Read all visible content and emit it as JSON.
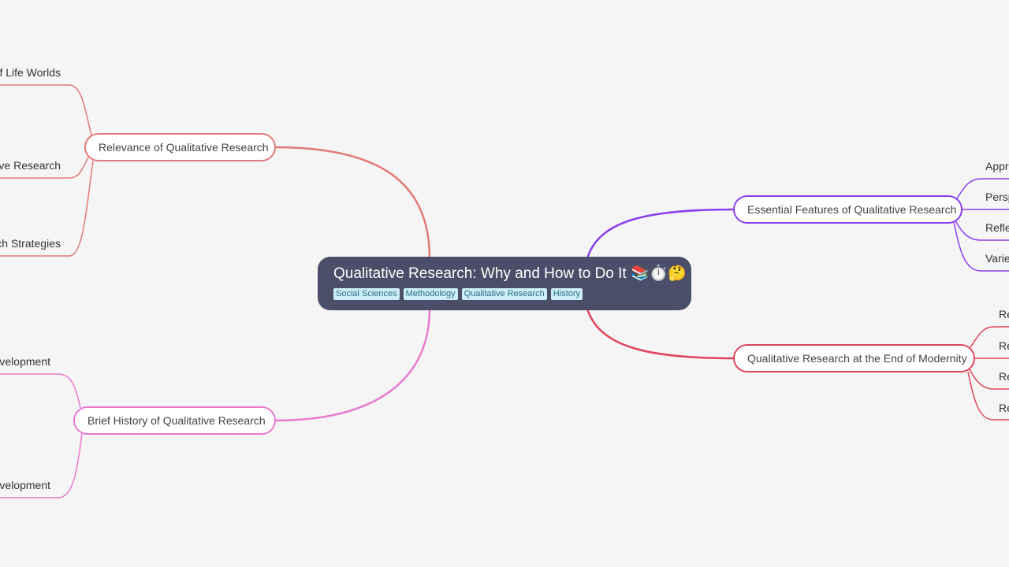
{
  "root": {
    "title": "Qualitative Research: Why and How to Do It 📚⏱️🤔",
    "tags": [
      "Social Sciences",
      "Methodology",
      "Qualitative Research",
      "History"
    ],
    "color": "#4a4e69"
  },
  "branches": [
    {
      "label": "Relevance of Qualitative Research",
      "color": "#e07a7a",
      "children": [
        "of Life Worlds",
        "tive Research",
        "ch Strategies"
      ]
    },
    {
      "label": "Brief History of Qualitative Research",
      "color": "#e879cf",
      "children": [
        "velopment",
        "velopment"
      ]
    },
    {
      "label": "Essential Features of Qualitative Research",
      "color": "#8a3ff0",
      "children": [
        "Appro",
        "Persp",
        "Refle",
        "Varie"
      ]
    },
    {
      "label": "Qualitative Research at the End of Modernity",
      "color": "#e0445a",
      "children": [
        "Re",
        "Re",
        "Re",
        "Re"
      ]
    }
  ]
}
